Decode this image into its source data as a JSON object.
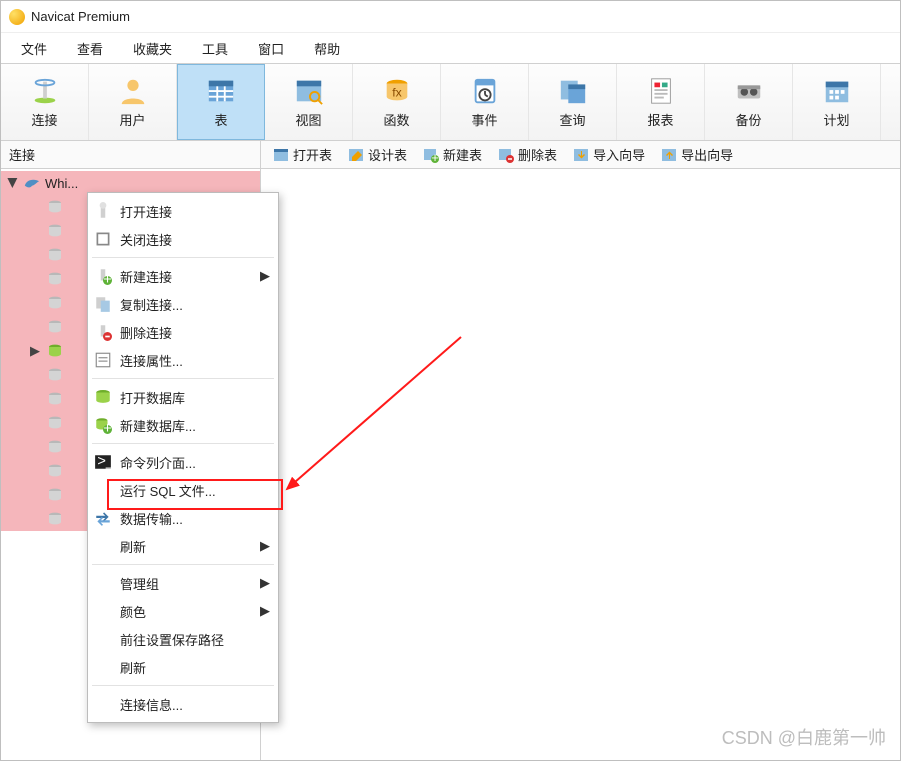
{
  "title": "Navicat Premium",
  "menubar": [
    "文件",
    "查看",
    "收藏夹",
    "工具",
    "窗口",
    "帮助"
  ],
  "toolbar": [
    {
      "key": "connect",
      "label": "连接",
      "icon": "connect-icon"
    },
    {
      "key": "user",
      "label": "用户",
      "icon": "user-icon"
    },
    {
      "key": "table",
      "label": "表",
      "icon": "table-icon",
      "selected": true
    },
    {
      "key": "view",
      "label": "视图",
      "icon": "view-icon"
    },
    {
      "key": "function",
      "label": "函数",
      "icon": "function-icon"
    },
    {
      "key": "event",
      "label": "事件",
      "icon": "event-icon"
    },
    {
      "key": "query",
      "label": "查询",
      "icon": "query-icon"
    },
    {
      "key": "report",
      "label": "报表",
      "icon": "report-icon"
    },
    {
      "key": "backup",
      "label": "备份",
      "icon": "backup-icon"
    },
    {
      "key": "schedule",
      "label": "计划",
      "icon": "schedule-icon"
    }
  ],
  "pane_header": "连接",
  "table_tools": [
    {
      "key": "open",
      "label": "打开表"
    },
    {
      "key": "design",
      "label": "设计表"
    },
    {
      "key": "new",
      "label": "新建表"
    },
    {
      "key": "delete",
      "label": "删除表"
    },
    {
      "key": "import",
      "label": "导入向导"
    },
    {
      "key": "export",
      "label": "导出向导"
    }
  ],
  "connection": {
    "name": "Whi...",
    "active_db_index": 6,
    "db_count": 14
  },
  "context_menu": [
    {
      "key": "open-conn",
      "label": "打开连接",
      "icon": "link-open",
      "disabled": true
    },
    {
      "key": "close-conn",
      "label": "关闭连接",
      "icon": "link-close"
    },
    {
      "sep": true
    },
    {
      "key": "new-conn",
      "label": "新建连接",
      "icon": "link-new",
      "submenu": true
    },
    {
      "key": "dup-conn",
      "label": "复制连接...",
      "icon": "link-dup"
    },
    {
      "key": "del-conn",
      "label": "删除连接",
      "icon": "link-del"
    },
    {
      "key": "conn-prop",
      "label": "连接属性...",
      "icon": "link-prop"
    },
    {
      "sep": true
    },
    {
      "key": "open-db",
      "label": "打开数据库",
      "icon": "db-open"
    },
    {
      "key": "new-db",
      "label": "新建数据库...",
      "icon": "db-new"
    },
    {
      "sep": true
    },
    {
      "key": "cli",
      "label": "命令列介面...",
      "icon": "terminal"
    },
    {
      "key": "run-sql",
      "label": "运行 SQL 文件...",
      "icon": "blank",
      "highlighted": true
    },
    {
      "key": "transfer",
      "label": "数据传输...",
      "icon": "transfer"
    },
    {
      "key": "refresh",
      "label": "刷新",
      "submenu": true
    },
    {
      "sep": true
    },
    {
      "key": "group",
      "label": "管理组",
      "submenu": true
    },
    {
      "key": "color",
      "label": "颜色",
      "submenu": true
    },
    {
      "key": "save-path",
      "label": "前往设置保存路径"
    },
    {
      "key": "refresh2",
      "label": "刷新"
    },
    {
      "sep": true
    },
    {
      "key": "conn-info",
      "label": "连接信息..."
    }
  ],
  "watermark": "CSDN @白鹿第一帅"
}
